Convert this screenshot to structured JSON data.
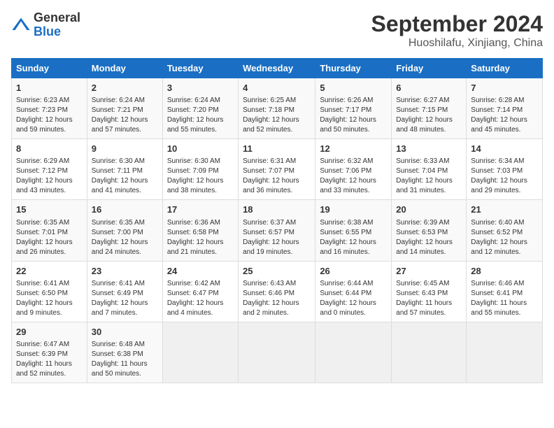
{
  "header": {
    "logo_general": "General",
    "logo_blue": "Blue",
    "month_title": "September 2024",
    "location": "Huoshilafu, Xinjiang, China"
  },
  "days_of_week": [
    "Sunday",
    "Monday",
    "Tuesday",
    "Wednesday",
    "Thursday",
    "Friday",
    "Saturday"
  ],
  "weeks": [
    [
      {
        "day": "1",
        "info": "Sunrise: 6:23 AM\nSunset: 7:23 PM\nDaylight: 12 hours\nand 59 minutes."
      },
      {
        "day": "2",
        "info": "Sunrise: 6:24 AM\nSunset: 7:21 PM\nDaylight: 12 hours\nand 57 minutes."
      },
      {
        "day": "3",
        "info": "Sunrise: 6:24 AM\nSunset: 7:20 PM\nDaylight: 12 hours\nand 55 minutes."
      },
      {
        "day": "4",
        "info": "Sunrise: 6:25 AM\nSunset: 7:18 PM\nDaylight: 12 hours\nand 52 minutes."
      },
      {
        "day": "5",
        "info": "Sunrise: 6:26 AM\nSunset: 7:17 PM\nDaylight: 12 hours\nand 50 minutes."
      },
      {
        "day": "6",
        "info": "Sunrise: 6:27 AM\nSunset: 7:15 PM\nDaylight: 12 hours\nand 48 minutes."
      },
      {
        "day": "7",
        "info": "Sunrise: 6:28 AM\nSunset: 7:14 PM\nDaylight: 12 hours\nand 45 minutes."
      }
    ],
    [
      {
        "day": "8",
        "info": "Sunrise: 6:29 AM\nSunset: 7:12 PM\nDaylight: 12 hours\nand 43 minutes."
      },
      {
        "day": "9",
        "info": "Sunrise: 6:30 AM\nSunset: 7:11 PM\nDaylight: 12 hours\nand 41 minutes."
      },
      {
        "day": "10",
        "info": "Sunrise: 6:30 AM\nSunset: 7:09 PM\nDaylight: 12 hours\nand 38 minutes."
      },
      {
        "day": "11",
        "info": "Sunrise: 6:31 AM\nSunset: 7:07 PM\nDaylight: 12 hours\nand 36 minutes."
      },
      {
        "day": "12",
        "info": "Sunrise: 6:32 AM\nSunset: 7:06 PM\nDaylight: 12 hours\nand 33 minutes."
      },
      {
        "day": "13",
        "info": "Sunrise: 6:33 AM\nSunset: 7:04 PM\nDaylight: 12 hours\nand 31 minutes."
      },
      {
        "day": "14",
        "info": "Sunrise: 6:34 AM\nSunset: 7:03 PM\nDaylight: 12 hours\nand 29 minutes."
      }
    ],
    [
      {
        "day": "15",
        "info": "Sunrise: 6:35 AM\nSunset: 7:01 PM\nDaylight: 12 hours\nand 26 minutes."
      },
      {
        "day": "16",
        "info": "Sunrise: 6:35 AM\nSunset: 7:00 PM\nDaylight: 12 hours\nand 24 minutes."
      },
      {
        "day": "17",
        "info": "Sunrise: 6:36 AM\nSunset: 6:58 PM\nDaylight: 12 hours\nand 21 minutes."
      },
      {
        "day": "18",
        "info": "Sunrise: 6:37 AM\nSunset: 6:57 PM\nDaylight: 12 hours\nand 19 minutes."
      },
      {
        "day": "19",
        "info": "Sunrise: 6:38 AM\nSunset: 6:55 PM\nDaylight: 12 hours\nand 16 minutes."
      },
      {
        "day": "20",
        "info": "Sunrise: 6:39 AM\nSunset: 6:53 PM\nDaylight: 12 hours\nand 14 minutes."
      },
      {
        "day": "21",
        "info": "Sunrise: 6:40 AM\nSunset: 6:52 PM\nDaylight: 12 hours\nand 12 minutes."
      }
    ],
    [
      {
        "day": "22",
        "info": "Sunrise: 6:41 AM\nSunset: 6:50 PM\nDaylight: 12 hours\nand 9 minutes."
      },
      {
        "day": "23",
        "info": "Sunrise: 6:41 AM\nSunset: 6:49 PM\nDaylight: 12 hours\nand 7 minutes."
      },
      {
        "day": "24",
        "info": "Sunrise: 6:42 AM\nSunset: 6:47 PM\nDaylight: 12 hours\nand 4 minutes."
      },
      {
        "day": "25",
        "info": "Sunrise: 6:43 AM\nSunset: 6:46 PM\nDaylight: 12 hours\nand 2 minutes."
      },
      {
        "day": "26",
        "info": "Sunrise: 6:44 AM\nSunset: 6:44 PM\nDaylight: 12 hours\nand 0 minutes."
      },
      {
        "day": "27",
        "info": "Sunrise: 6:45 AM\nSunset: 6:43 PM\nDaylight: 11 hours\nand 57 minutes."
      },
      {
        "day": "28",
        "info": "Sunrise: 6:46 AM\nSunset: 6:41 PM\nDaylight: 11 hours\nand 55 minutes."
      }
    ],
    [
      {
        "day": "29",
        "info": "Sunrise: 6:47 AM\nSunset: 6:39 PM\nDaylight: 11 hours\nand 52 minutes."
      },
      {
        "day": "30",
        "info": "Sunrise: 6:48 AM\nSunset: 6:38 PM\nDaylight: 11 hours\nand 50 minutes."
      },
      {
        "day": "",
        "info": ""
      },
      {
        "day": "",
        "info": ""
      },
      {
        "day": "",
        "info": ""
      },
      {
        "day": "",
        "info": ""
      },
      {
        "day": "",
        "info": ""
      }
    ]
  ]
}
